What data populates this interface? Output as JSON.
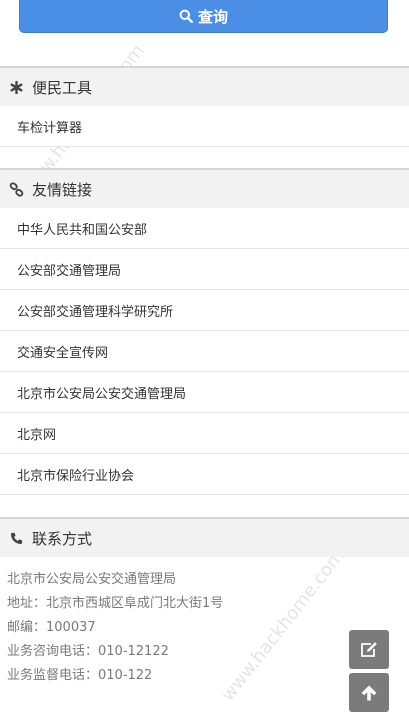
{
  "search": {
    "label": "查询"
  },
  "tools": {
    "title": "便民工具",
    "items": [
      {
        "label": "车检计算器"
      }
    ]
  },
  "links": {
    "title": "友情链接",
    "items": [
      {
        "label": "中华人民共和国公安部"
      },
      {
        "label": "公安部交通管理局"
      },
      {
        "label": "公安部交通管理科学研究所"
      },
      {
        "label": "交通安全宣传网"
      },
      {
        "label": "北京市公安局公安交通管理局"
      },
      {
        "label": "北京网"
      },
      {
        "label": "北京市保险行业协会"
      }
    ]
  },
  "contact": {
    "title": "联系方式",
    "lines": [
      "北京市公安局公安交通管理局",
      "地址：北京市西城区阜成门北大街1号",
      "邮编：100037",
      "业务咨询电话：010-12122",
      "业务监督电话：010-122"
    ]
  },
  "watermark": "www.hackhome.com",
  "colors": {
    "accent": "#4a8ee6",
    "float_button": "#7b7b7b",
    "section_bg": "#f2f2f2"
  },
  "icons": {
    "search": "search-icon",
    "tools": "asterisk-icon",
    "links": "link-icon",
    "contact": "phone-icon",
    "edit": "edit-icon",
    "top": "arrow-up-icon"
  }
}
